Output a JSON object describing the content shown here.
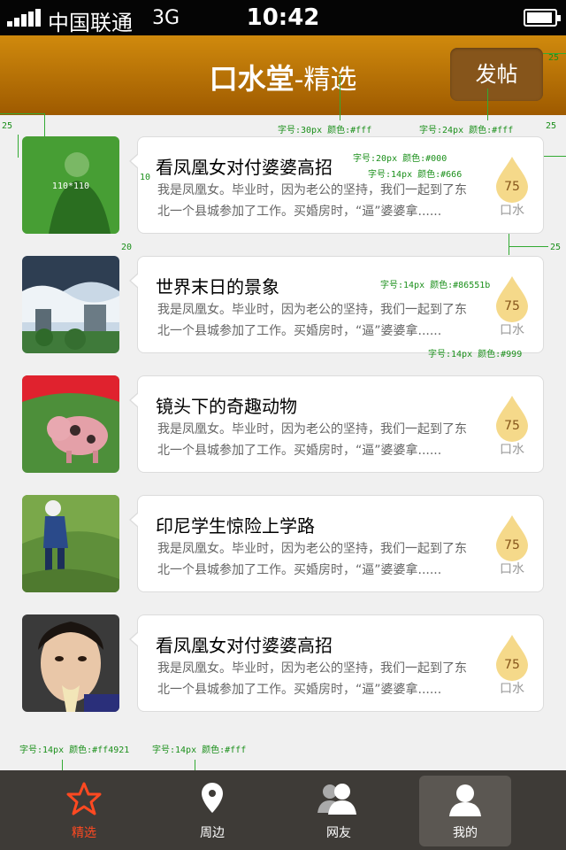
{
  "status_bar": {
    "carrier": "中国联通",
    "network": "3G",
    "time": "10:42"
  },
  "header": {
    "brand": "口水堂",
    "subtitle": "-精选",
    "post_button": "发帖"
  },
  "items": [
    {
      "title": "看凤凰女对付婆婆高招",
      "summary": "我是凤凰女。毕业时，因为老公的坚持，我们一起到了东北一个县城参加了工作。买婚房时，“逼”婆婆拿......",
      "count": "75",
      "count_label": "口水",
      "thumb_label": "110*110"
    },
    {
      "title": "世界末日的景象",
      "summary": "我是凤凰女。毕业时，因为老公的坚持，我们一起到了东北一个县城参加了工作。买婚房时，“逼”婆婆拿......",
      "count": "75",
      "count_label": "口水"
    },
    {
      "title": "镜头下的奇趣动物",
      "summary": "我是凤凰女。毕业时，因为老公的坚持，我们一起到了东北一个县城参加了工作。买婚房时，“逼”婆婆拿......",
      "count": "75",
      "count_label": "口水"
    },
    {
      "title": "印尼学生惊险上学路",
      "summary": "我是凤凰女。毕业时，因为老公的坚持，我们一起到了东北一个县城参加了工作。买婚房时，“逼”婆婆拿......",
      "count": "75",
      "count_label": "口水"
    },
    {
      "title": "看凤凰女对付婆婆高招",
      "summary": "我是凤凰女。毕业时，因为老公的坚持，我们一起到了东北一个县城参加了工作。买婚房时，“逼”婆婆拿......",
      "count": "75",
      "count_label": "口水"
    }
  ],
  "tabs": [
    {
      "label": "精选",
      "icon": "star-icon",
      "active": true
    },
    {
      "label": "周边",
      "icon": "location-pin-icon"
    },
    {
      "label": "网友",
      "icon": "friends-icon"
    },
    {
      "label": "我的",
      "icon": "user-icon"
    }
  ],
  "annotations": {
    "title_spec": "字号:30px 颜色:#fff",
    "button_spec": "字号:24px 颜色:#fff",
    "item_title_spec": "字号:20px 颜色:#000",
    "item_summary_spec": "字号:14px 颜色:#666",
    "count_spec": "字号:14px 颜色:#86551b",
    "count_label_spec": "字号:14px 颜色:#999",
    "tab_active_spec": "字号:14px 颜色:#ff4921",
    "tab_spec": "字号:14px 颜色:#fff",
    "m25a": "25",
    "m25b": "25",
    "m25c": "25",
    "m25d": "25",
    "m10": "10",
    "m20": "20"
  },
  "colors": {
    "header_top": "#d08a0d",
    "header_bottom": "#9e5a00",
    "post_button": "#86551b",
    "tab_bar": "#3e3b37",
    "tab_active": "#ff4921",
    "drop": "#f5d98a",
    "count": "#86551b"
  }
}
